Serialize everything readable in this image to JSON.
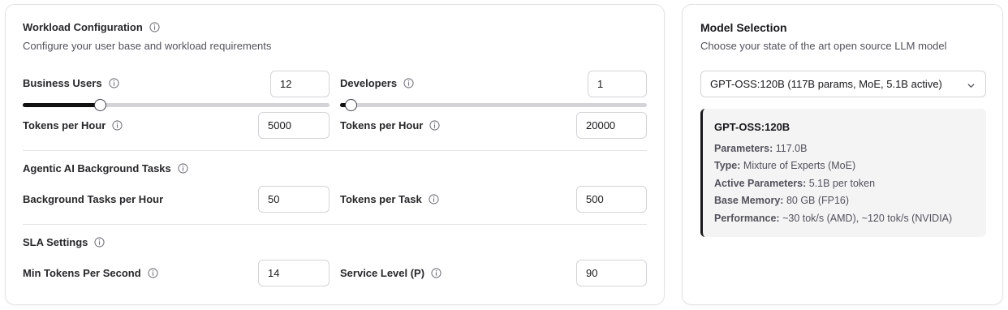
{
  "workload": {
    "title": "Workload Configuration",
    "subtitle": "Configure your user base and workload requirements",
    "business_users": {
      "label": "Business Users",
      "value": "12",
      "slider_fraction": 0.25
    },
    "business_tokens": {
      "label": "Tokens per Hour",
      "value": "5000"
    },
    "developers": {
      "label": "Developers",
      "value": "1",
      "slider_fraction": 0.035
    },
    "developer_tokens": {
      "label": "Tokens per Hour",
      "value": "20000"
    }
  },
  "agentic": {
    "title": "Agentic AI Background Tasks",
    "tasks_per_hour": {
      "label": "Background Tasks per Hour",
      "value": "50"
    },
    "tokens_per_task": {
      "label": "Tokens per Task",
      "value": "500"
    }
  },
  "sla": {
    "title": "SLA Settings",
    "min_tokens": {
      "label": "Min Tokens Per Second",
      "value": "14"
    },
    "service_level": {
      "label": "Service Level (P)",
      "value": "90"
    }
  },
  "model": {
    "title": "Model Selection",
    "subtitle": "Choose your state of the art open source LLM model",
    "selected": "GPT-OSS:120B (117B params, MoE, 5.1B active)",
    "name": "GPT-OSS:120B",
    "specs": [
      {
        "key": "Parameters:",
        "value": "117.0B"
      },
      {
        "key": "Type:",
        "value": "Mixture of Experts (MoE)"
      },
      {
        "key": "Active Parameters:",
        "value": "5.1B per token"
      },
      {
        "key": "Base Memory:",
        "value": "80 GB (FP16)"
      },
      {
        "key": "Performance:",
        "value": "~30 tok/s (AMD), ~120 tok/s (NVIDIA)"
      }
    ]
  },
  "icons": {
    "info": "info-icon",
    "chevron": "chevron-down-icon"
  },
  "colors": {
    "accent": "#111111",
    "border": "#d4d4d8",
    "panel": "#f4f4f5"
  }
}
